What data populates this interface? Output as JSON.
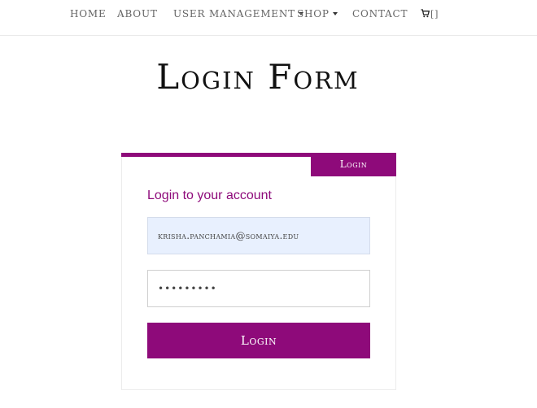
{
  "nav": {
    "home": "HOME",
    "about": "ABOUT",
    "user_management": "USER MANAGEMENT",
    "shop": "SHOP",
    "contact": "CONTACT",
    "cart_count": "[]",
    "cart_icon": "cart-icon"
  },
  "page": {
    "title": "Login Form"
  },
  "card": {
    "tab_label": "Login",
    "heading": "Login to your account",
    "email_value": "krisha.panchamia@somaiya.edu",
    "password_value": "•••••••••",
    "submit_label": "Login"
  },
  "colors": {
    "accent": "#8e0a7a",
    "autofill": "#e8f0fe"
  }
}
